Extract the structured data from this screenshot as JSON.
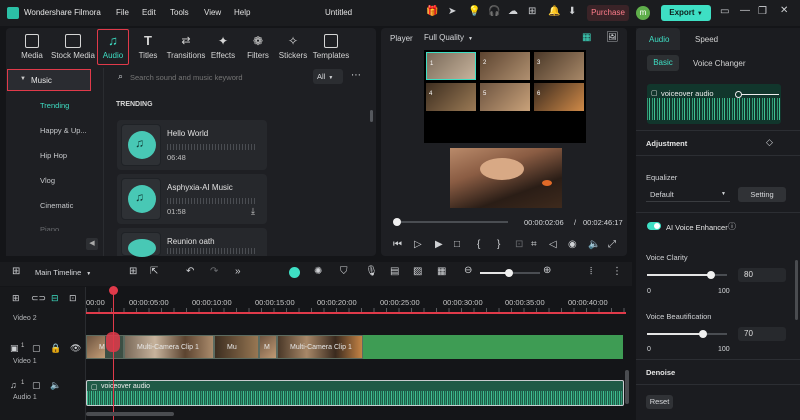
{
  "app": {
    "name": "Wondershare Filmora",
    "project_title": "Untitled"
  },
  "menu": [
    "File",
    "Edit",
    "Tools",
    "View",
    "Help"
  ],
  "titlebar": {
    "purchase_label": "Purchase",
    "export_label": "Export",
    "avatar_letter": "m"
  },
  "toolbar": [
    "Media",
    "Stock Media",
    "Audio",
    "Titles",
    "Transitions",
    "Effects",
    "Filters",
    "Stickers",
    "Templates"
  ],
  "library": {
    "category": "Music",
    "subcategories": [
      "Trending",
      "Happy & Up...",
      "Hip Hop",
      "Vlog",
      "Cinematic",
      "Piano"
    ],
    "search_placeholder": "Search sound and music keyword",
    "filter": "All",
    "section_title": "TRENDING",
    "tracks": [
      {
        "name": "Hello World",
        "duration": "06:48"
      },
      {
        "name": "Asphyxia-AI Music",
        "duration": "01:58"
      },
      {
        "name": "Reunion oath",
        "duration": ""
      }
    ]
  },
  "player": {
    "label": "Player",
    "quality": "Full Quality",
    "current_time": "00:00:02:06",
    "separator": "/",
    "total_time": "00:02:46:17",
    "thumb_numbers": [
      "1",
      "2",
      "3",
      "4",
      "5",
      "6"
    ]
  },
  "timeline": {
    "label": "Main Timeline",
    "ruler": [
      "00:00",
      "00:00:05:00",
      "00:00:10:00",
      "00:00:15:00",
      "00:00:20:00",
      "00:00:25:00",
      "00:00:30:00",
      "00:00:35:00",
      "00:00:40:00"
    ],
    "tracks": {
      "video2": "Video 2",
      "video1": "Video 1",
      "audio1": "Audio 1"
    },
    "clips": [
      "M",
      "Multi-Camera Clip 1",
      "Mu",
      "M",
      "Multi-Camera Clip 1"
    ],
    "audio_clip": "voiceover audio",
    "track_badges": {
      "video": "1",
      "audio": "1"
    }
  },
  "right_panel": {
    "tabs": [
      "Audio",
      "Speed"
    ],
    "subtabs": [
      "Basic",
      "Voice Changer"
    ],
    "clip_name": "voiceover audio",
    "adjustment": "Adjustment",
    "equalizer": {
      "label": "Equalizer",
      "value": "Default",
      "button": "Setting"
    },
    "ai_voice": "AI Voice Enhancer",
    "voice_clarity": {
      "label": "Voice Clarity",
      "value": "80",
      "min": "0",
      "max": "100",
      "level": 0.8
    },
    "voice_beautification": {
      "label": "Voice Beautification",
      "value": "70",
      "min": "0",
      "max": "100",
      "level": 0.7
    },
    "denoise": "Denoise",
    "reset": "Reset"
  },
  "colors": {
    "accent": "#3edfc4",
    "highlight": "#e03a4a",
    "audio": "#31a783",
    "video_clip": "#3c4f44"
  }
}
